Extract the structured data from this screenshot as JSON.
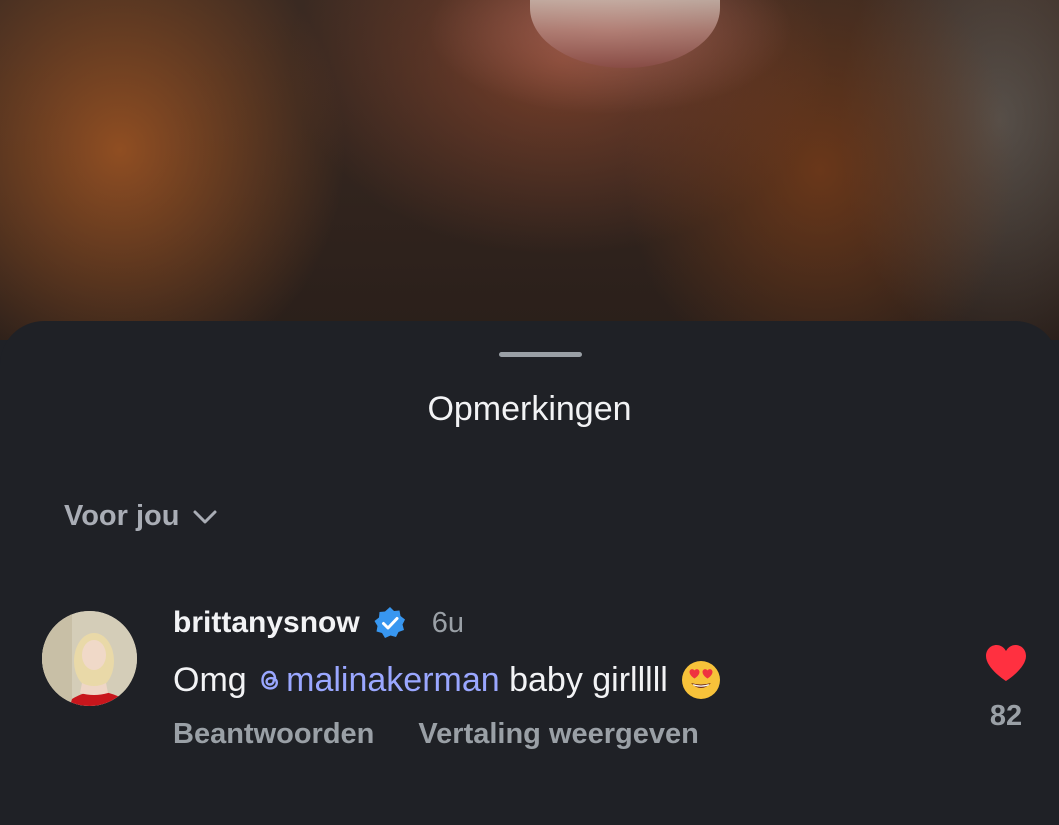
{
  "sheet": {
    "title": "Opmerkingen",
    "sort_label": "Voor jou",
    "sort_icon": "chevron-down-icon"
  },
  "comment": {
    "username": "brittanysnow",
    "verified_icon": "verified-badge-icon",
    "timestamp": "6u",
    "text_before": "Omg ",
    "mention": "malinakerman",
    "text_after": " baby girlllll",
    "emoji": "heart-eyes-emoji",
    "reply_label": "Beantwoorden",
    "translate_label": "Vertaling weergeven",
    "like_icon": "heart-icon",
    "like_count": "82",
    "colors": {
      "mention": "#9aa7ff",
      "like": "#ff3040",
      "verified": "#3897f0"
    }
  }
}
